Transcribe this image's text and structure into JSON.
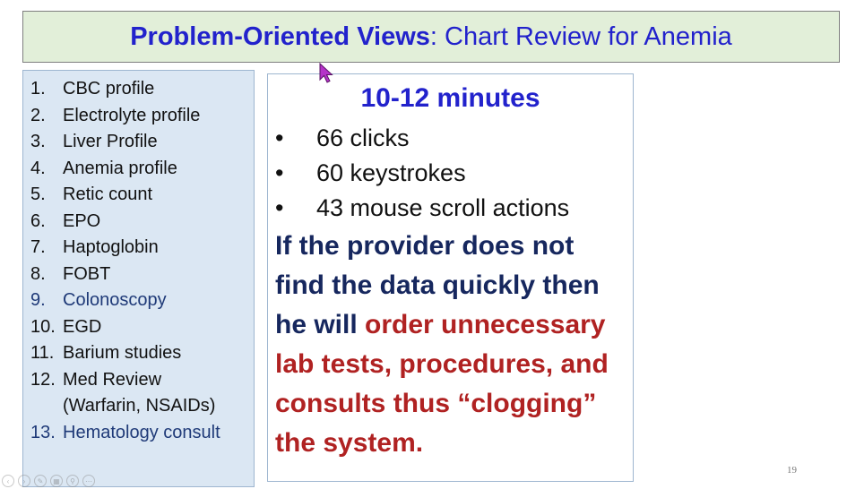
{
  "title": {
    "bold": "Problem-Oriented Views",
    "rest": ": Chart Review for Anemia"
  },
  "checklist": [
    {
      "num": "1.",
      "text": "CBC profile"
    },
    {
      "num": "2.",
      "text": "Electrolyte profile"
    },
    {
      "num": "3.",
      "text": "Liver Profile"
    },
    {
      "num": "4.",
      "text": "Anemia profile"
    },
    {
      "num": "5.",
      "text": "Retic count"
    },
    {
      "num": "6.",
      "text": "EPO"
    },
    {
      "num": "7.",
      "text": "Haptoglobin"
    },
    {
      "num": "8.",
      "text": "FOBT"
    },
    {
      "num": "9.",
      "text": "Colonoscopy"
    },
    {
      "num": "10.",
      "text": "EGD"
    },
    {
      "num": "11.",
      "text": "Barium studies"
    },
    {
      "num": "12.",
      "text": "Med Review"
    },
    {
      "num": "",
      "text": "(Warfarin, NSAIDs)"
    },
    {
      "num": "13.",
      "text": "Hematology consult"
    }
  ],
  "duration": "10-12 minutes",
  "metrics": {
    "bullet": "•",
    "items": [
      "66 clicks",
      "60 keystrokes",
      "43 mouse scroll actions"
    ]
  },
  "statement": {
    "part1": "If the provider does not find the data quickly then he will ",
    "part2": "order unnecessary lab tests, procedures, and consults thus “clogging” the system."
  },
  "page_number": "19",
  "colors": {
    "title_bg": "#e2efd9",
    "title_text": "#2222cc",
    "left_panel_bg": "#dbe7f3",
    "statement_navy": "#16275e",
    "statement_red": "#b02222"
  }
}
